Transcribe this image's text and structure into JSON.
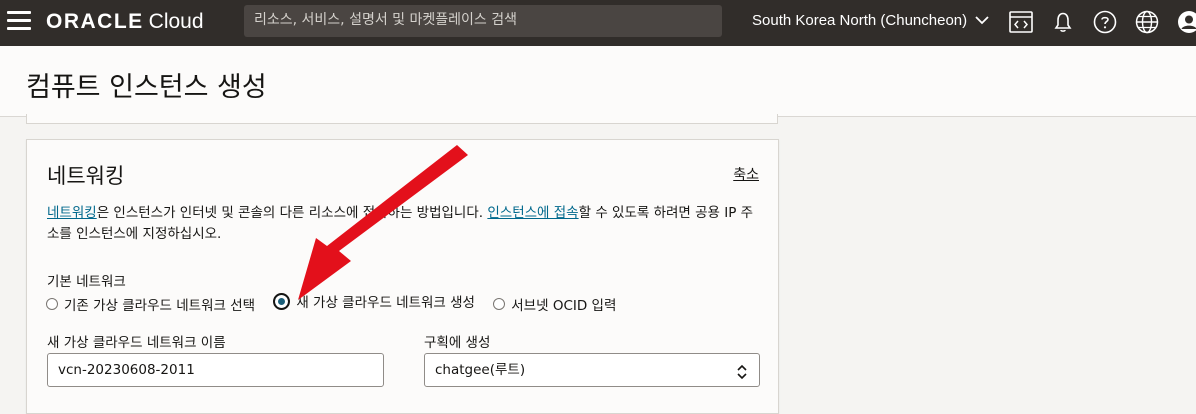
{
  "topbar": {
    "brand": "ORACLE",
    "product": "Cloud",
    "search_placeholder": "리소스, 서비스, 설명서 및 마켓플레이스 검색",
    "region": "South Korea North (Chuncheon)",
    "icons": [
      "hamburger-icon",
      "code-editor-icon",
      "bell-icon",
      "help-icon",
      "globe-icon",
      "profile-icon"
    ]
  },
  "page": {
    "title": "컴퓨트 인스턴스 생성"
  },
  "networking": {
    "title": "네트워킹",
    "collapse_label": "축소",
    "desc_link1": "네트워킹",
    "desc_text1": "은 인스턴스가 인터넷 및 콘솔의 다른 리소스에 접속하는 방법입니다. ",
    "desc_link2": "인스턴스에 접속",
    "desc_text2": "할 수 있도록 하려면 공용 IP 주소를 인스턴스에 지정하십시오.",
    "primary_network_label": "기본 네트워크",
    "options": [
      {
        "label": "기존 가상 클라우드 네트워크 선택",
        "selected": false
      },
      {
        "label": "새 가상 클라우드 네트워크 생성",
        "selected": true
      },
      {
        "label": "서브넷 OCID 입력",
        "selected": false
      }
    ],
    "vcn_name_label": "새 가상 클라우드 네트워크 이름",
    "vcn_name_value": "vcn-20230608-2011",
    "compartment_label": "구획에 생성",
    "compartment_value": "chatgee(루트)"
  },
  "annotation": {
    "arrow_color": "#e3101b"
  }
}
